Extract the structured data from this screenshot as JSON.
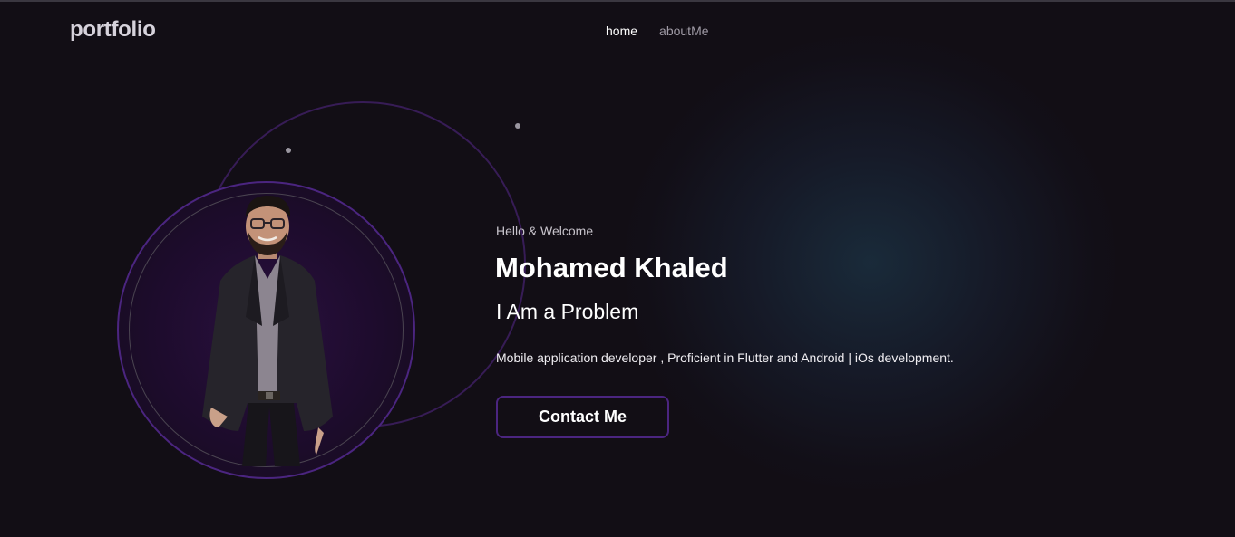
{
  "header": {
    "logo": "portfolio",
    "nav": [
      {
        "label": "home",
        "active": true
      },
      {
        "label": "aboutMe",
        "active": false
      }
    ]
  },
  "hero": {
    "greeting": "Hello & Welcome",
    "name": "Mohamed Khaled",
    "role": "I Am a Problem",
    "description": "Mobile application developer , Proficient in Flutter and Android | iOs  development.",
    "cta_label": "Contact Me"
  },
  "colors": {
    "background": "#120e15",
    "accent": "#4b2580",
    "text": "#ffffff"
  }
}
